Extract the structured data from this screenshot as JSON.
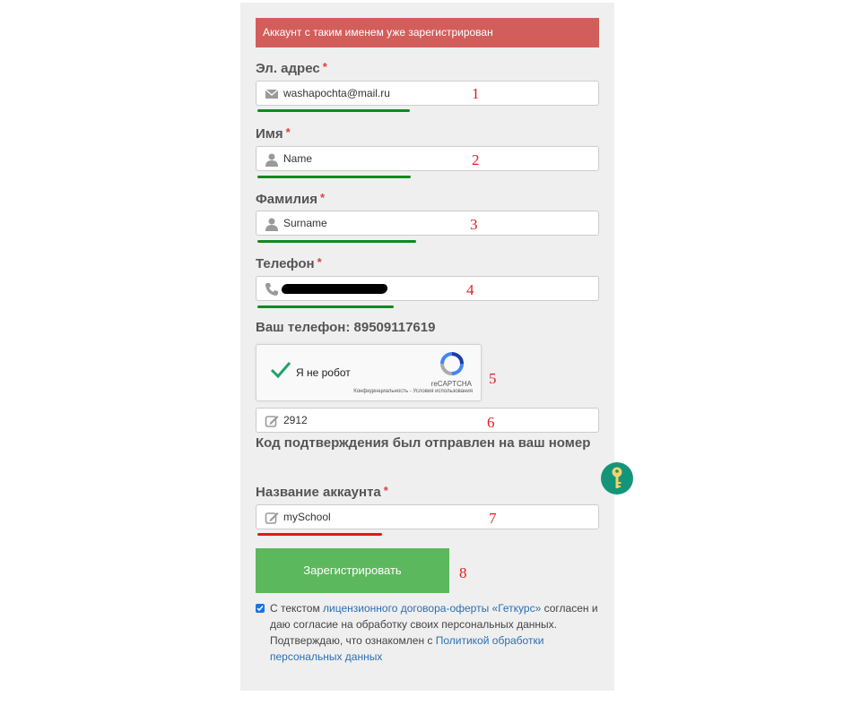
{
  "error_message": "Аккаунт с таким именем уже зарегистрирован",
  "fields": {
    "email": {
      "label": "Эл. адрес",
      "required_mark": "*",
      "value": "washapochta@mail.ru",
      "annotation": "1"
    },
    "first_name": {
      "label": "Имя",
      "required_mark": "*",
      "value": "Name",
      "annotation": "2"
    },
    "last_name": {
      "label": "Фамилия",
      "required_mark": "*",
      "value": "Surname",
      "annotation": "3"
    },
    "phone": {
      "label": "Телефон",
      "required_mark": "*",
      "value": "",
      "annotation": "4"
    }
  },
  "phone_info": "Ваш телефон: 89509117619",
  "captcha": {
    "label": "Я не робот",
    "brand": "reCAPTCHA",
    "footer": "Конфиденциальность - Условия использования",
    "annotation": "5"
  },
  "code": {
    "value": "2912",
    "annotation": "6",
    "hint": "Код подтверждения был отправлен на ваш номер"
  },
  "account": {
    "label": "Название аккаунта",
    "required_mark": "*",
    "value": "mySchool",
    "annotation": "7"
  },
  "submit": {
    "label": "Зарегистрировать",
    "annotation": "8"
  },
  "consent": {
    "checked": true,
    "text_1": "С текстом ",
    "link_1": "лицензионного договора-оферты «Геткурс»",
    "text_2": " согласен и даю согласие на обработку своих персональных данных. Подтверждаю, что ознакомлен с ",
    "link_2": "Политикой обработки персональных данных"
  },
  "colors": {
    "error_bg": "#d25e5c",
    "button": "#5cb85c",
    "link": "#2a6fb3",
    "valid_underline": "#0d8a20",
    "invalid_underline": "#e8141a"
  },
  "icons": [
    "envelope-icon",
    "user-icon",
    "phone-icon",
    "edit-icon",
    "checkmark-icon",
    "recaptcha-logo-icon",
    "key-icon"
  ]
}
